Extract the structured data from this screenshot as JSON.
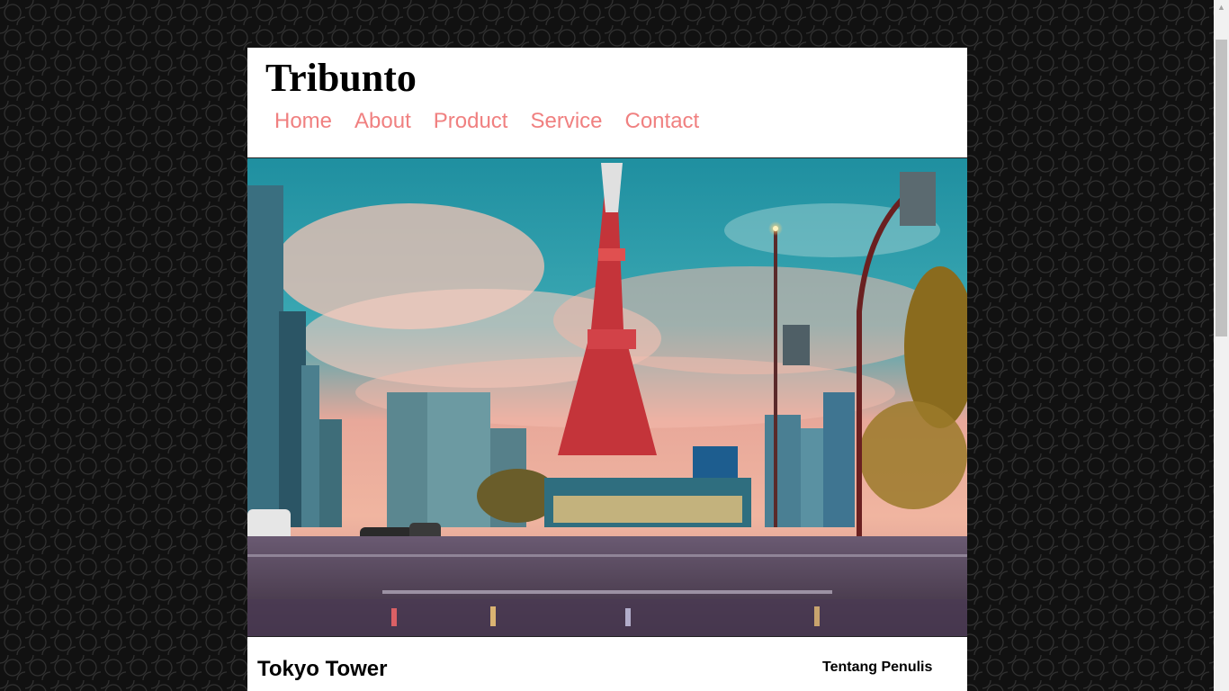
{
  "site": {
    "brand": "Tribunto",
    "nav": [
      "Home",
      "About",
      "Product",
      "Service",
      "Contact"
    ]
  },
  "hero": {
    "alt": "Tokyo Tower at dusk"
  },
  "article": {
    "title": "Tokyo Tower"
  },
  "sidebar": {
    "title": "Tentang Penulis"
  },
  "colors": {
    "nav_link": "#f08080",
    "page_bg": "#111111",
    "content_bg": "#ffffff"
  }
}
